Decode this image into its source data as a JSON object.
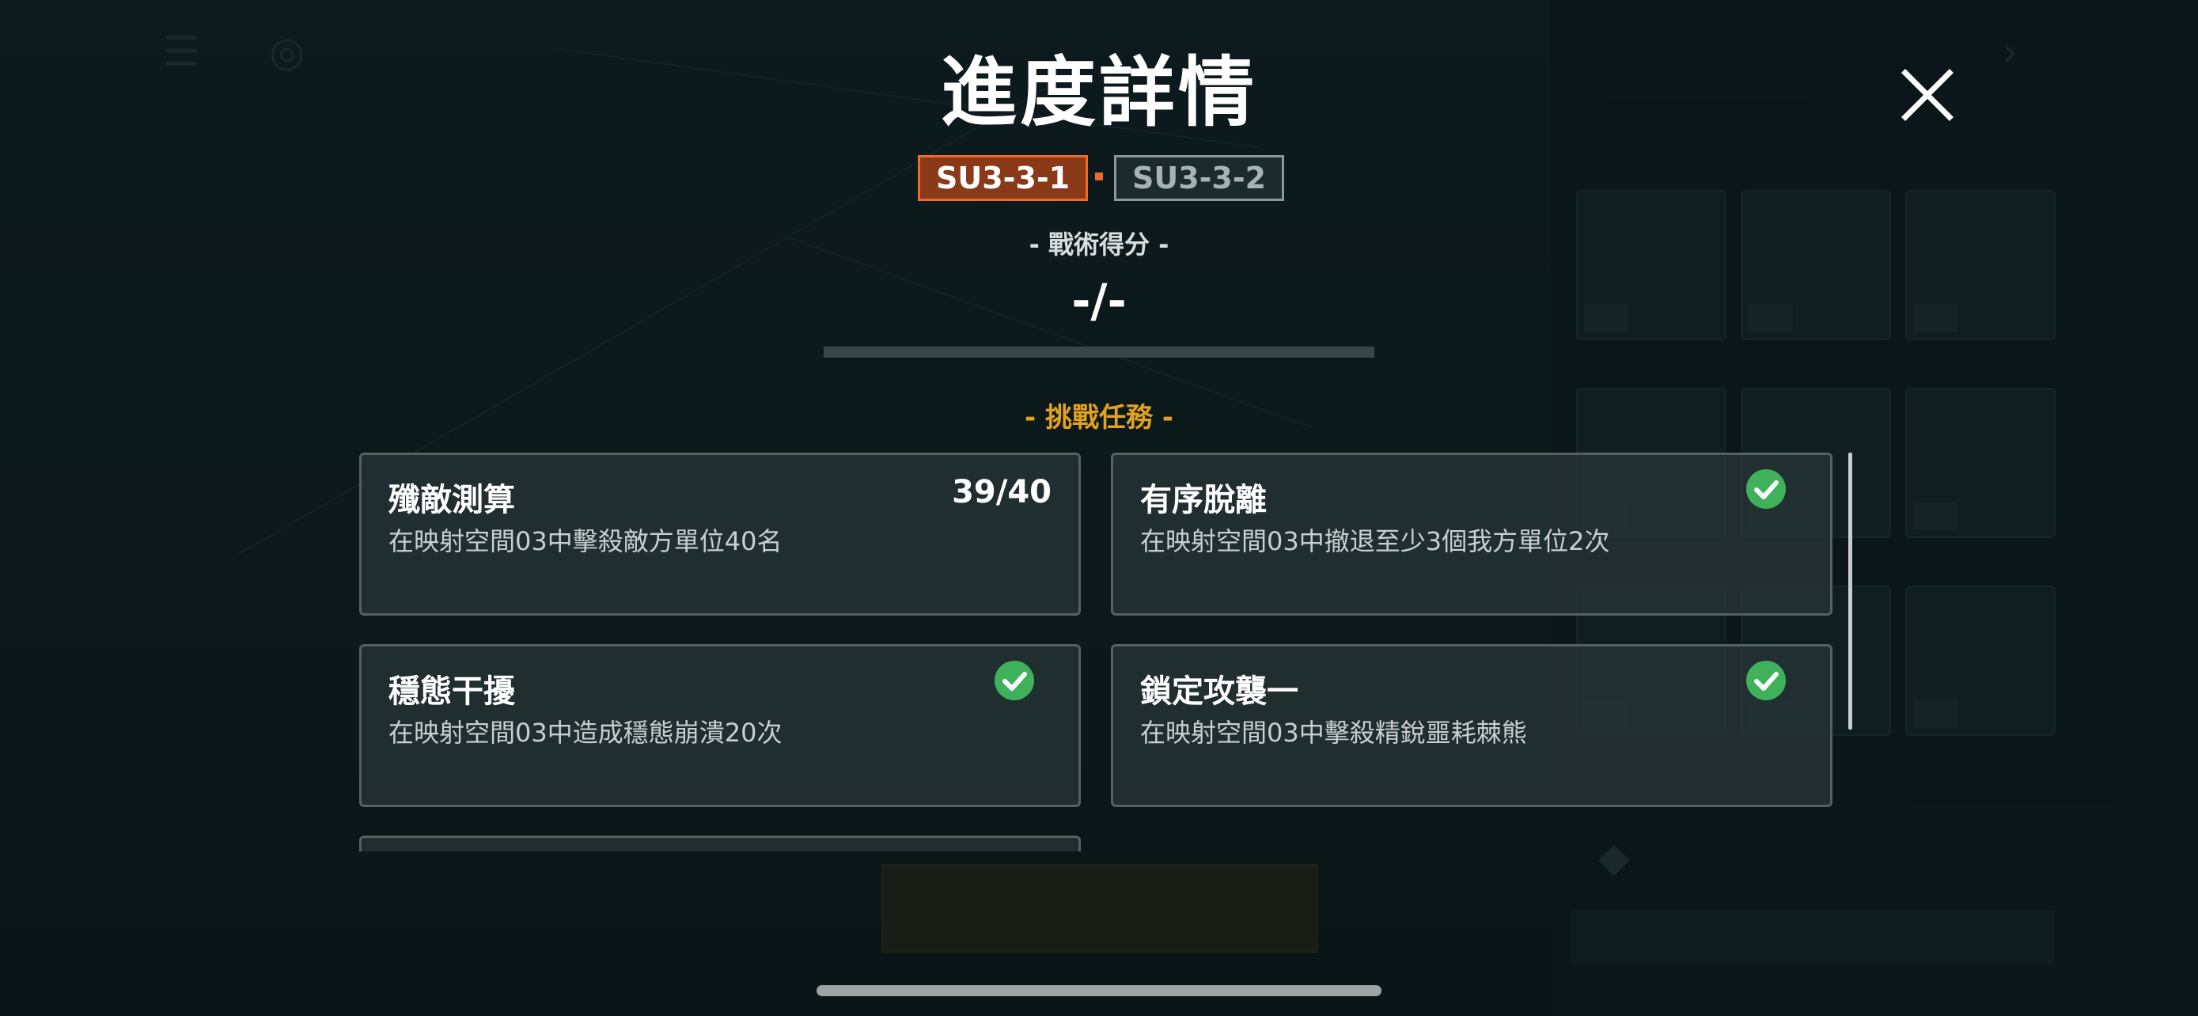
{
  "modal": {
    "title": "進度詳情",
    "stage_tabs": [
      {
        "label": "SU3-3-1",
        "active": true
      },
      {
        "label": "SU3-3-2",
        "active": false
      }
    ],
    "score_label": "- 戰術得分 -",
    "score_value": "-/-",
    "challenge_label": "- 挑戰任務 -",
    "tasks": [
      {
        "title": "殲敵測算",
        "description": "在映射空間03中擊殺敵方單位40名",
        "progress": "39/40",
        "completed": false
      },
      {
        "title": "有序脫離",
        "description": "在映射空間03中撤退至少3個我方單位2次",
        "completed": true
      },
      {
        "title": "穩態干擾",
        "description": "在映射空間03中造成穩態崩潰20次",
        "completed": true
      },
      {
        "title": "鎖定攻襲一",
        "description": "在映射空間03中擊殺精銳噩耗棘熊",
        "completed": true
      }
    ]
  },
  "colors": {
    "accent_orange": "#f06a2a",
    "challenge_gold": "#e3a21d",
    "check_green": "#3fb15a",
    "background": "#0f1c1f"
  },
  "icons": {
    "close": "close-icon",
    "check": "check-circle-icon"
  }
}
